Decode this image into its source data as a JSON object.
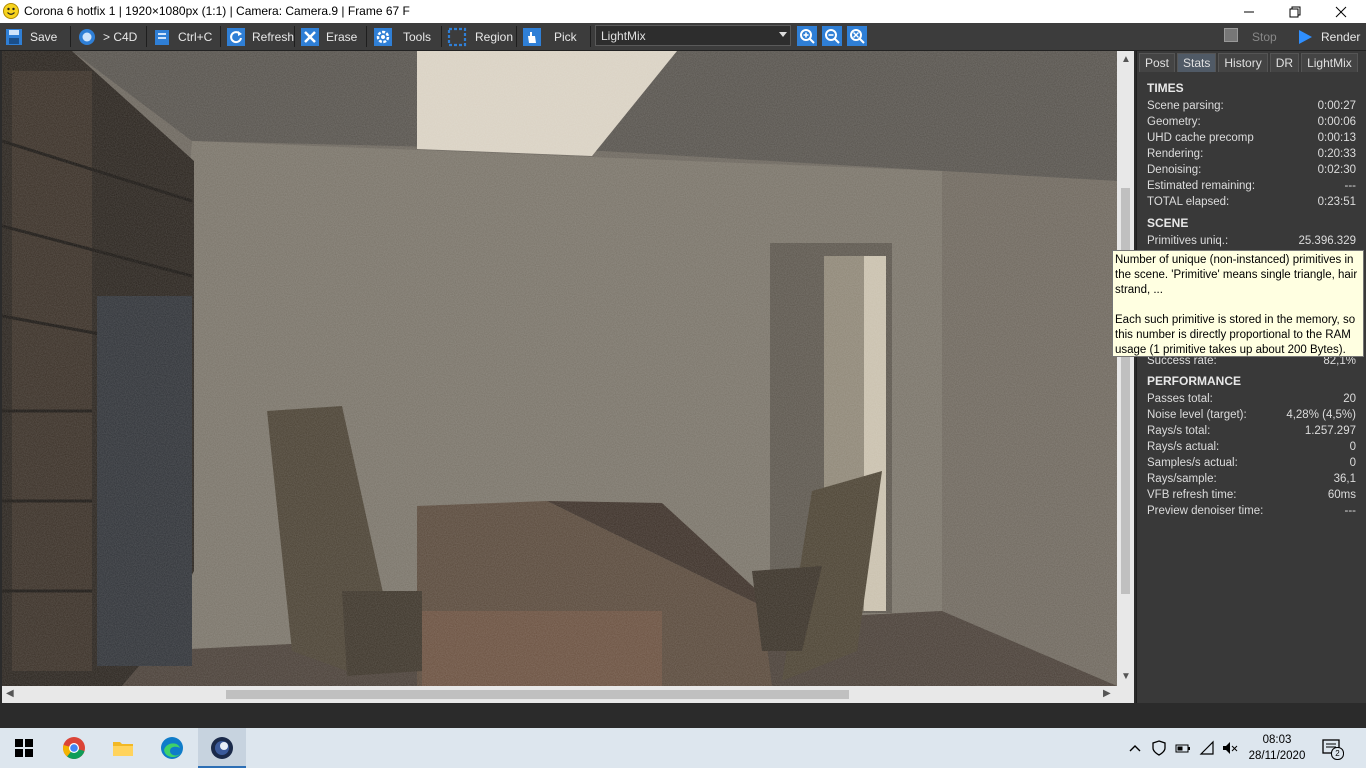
{
  "window": {
    "title": "Corona 6 hotfix 1 | 1920×1080px (1:1) | Camera: Camera.9 | Frame 67 F"
  },
  "toolbar": {
    "save": "Save",
    "c4d": "> C4D",
    "ctrlc": "Ctrl+C",
    "refresh": "Refresh",
    "erase": "Erase",
    "tools": "Tools",
    "region": "Region",
    "pick": "Pick",
    "lightmix_selected": "LightMix",
    "stop": "Stop",
    "render": "Render"
  },
  "panel": {
    "tabs": [
      "Post",
      "Stats",
      "History",
      "DR",
      "LightMix"
    ],
    "active_tab": "Stats",
    "times_title": "TIMES",
    "times": [
      {
        "k": "Scene parsing:",
        "v": "0:00:27"
      },
      {
        "k": "Geometry:",
        "v": "0:00:06"
      },
      {
        "k": "UHD cache precomp",
        "v": "0:00:13"
      },
      {
        "k": "Rendering:",
        "v": "0:20:33"
      },
      {
        "k": "Denoising:",
        "v": "0:02:30"
      },
      {
        "k": "Estimated remaining:",
        "v": "---"
      },
      {
        "k": "TOTAL elapsed:",
        "v": "0:23:51"
      }
    ],
    "scene_title": "SCENE",
    "scene": [
      {
        "k": "Primitives uniq.:",
        "v": "25.396.329"
      },
      {
        "k": "Success rate:",
        "v": "82,1%"
      }
    ],
    "performance_title": "PERFORMANCE",
    "performance": [
      {
        "k": "Passes total:",
        "v": "20"
      },
      {
        "k": "Noise level (target):",
        "v": "4,28% (4,5%)"
      },
      {
        "k": "Rays/s total:",
        "v": "1.257.297"
      },
      {
        "k": "Rays/s actual:",
        "v": "0"
      },
      {
        "k": "Samples/s actual:",
        "v": "0"
      },
      {
        "k": "Rays/sample:",
        "v": "36,1"
      },
      {
        "k": "VFB refresh time:",
        "v": "60ms"
      },
      {
        "k": "Preview denoiser time:",
        "v": "---"
      }
    ]
  },
  "tooltip": {
    "p1": "Number of unique (non-instanced) primitives in the scene. 'Primitive' means single triangle, hair strand, ...",
    "p2": "Each such primitive is stored in the memory, so this number is directly proportional to the RAM usage (1 primitive takes up about 200 Bytes)."
  },
  "taskbar": {
    "time": "08:03",
    "date": "28/11/2020",
    "notification_count": "2"
  }
}
